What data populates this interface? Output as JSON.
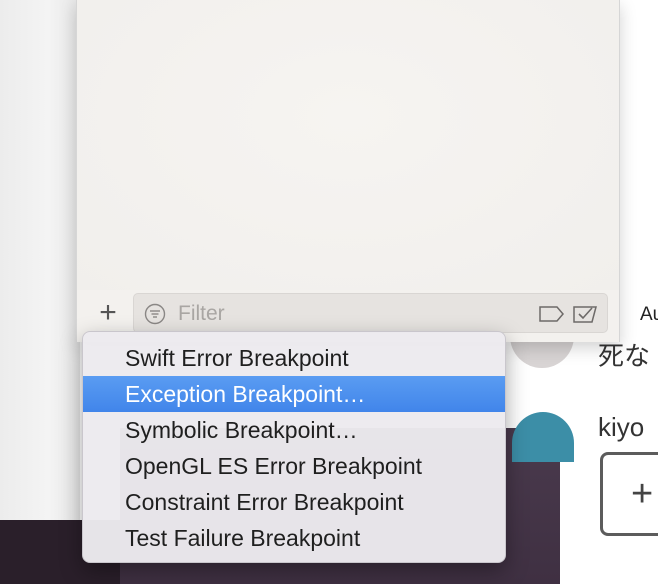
{
  "background": {
    "right_app": {
      "label_top": "Au",
      "row1_text": "死な",
      "row2_text": "kiyo",
      "add_symbol": "+"
    }
  },
  "panel": {
    "add_button_label": "+",
    "filter": {
      "placeholder": "Filter",
      "value": ""
    },
    "icons": [
      "filter-icon",
      "tag-icon",
      "checkbox-icon"
    ]
  },
  "menu": {
    "items": [
      {
        "label": "Swift Error Breakpoint",
        "selected": false
      },
      {
        "label": "Exception Breakpoint…",
        "selected": true
      },
      {
        "label": "Symbolic Breakpoint…",
        "selected": false
      },
      {
        "label": "OpenGL ES Error Breakpoint",
        "selected": false
      },
      {
        "label": "Constraint Error Breakpoint",
        "selected": false
      },
      {
        "label": "Test Failure Breakpoint",
        "selected": false
      }
    ]
  },
  "colors": {
    "selection": "#4a8ff0",
    "panel_bg": "#f3f1ee"
  }
}
